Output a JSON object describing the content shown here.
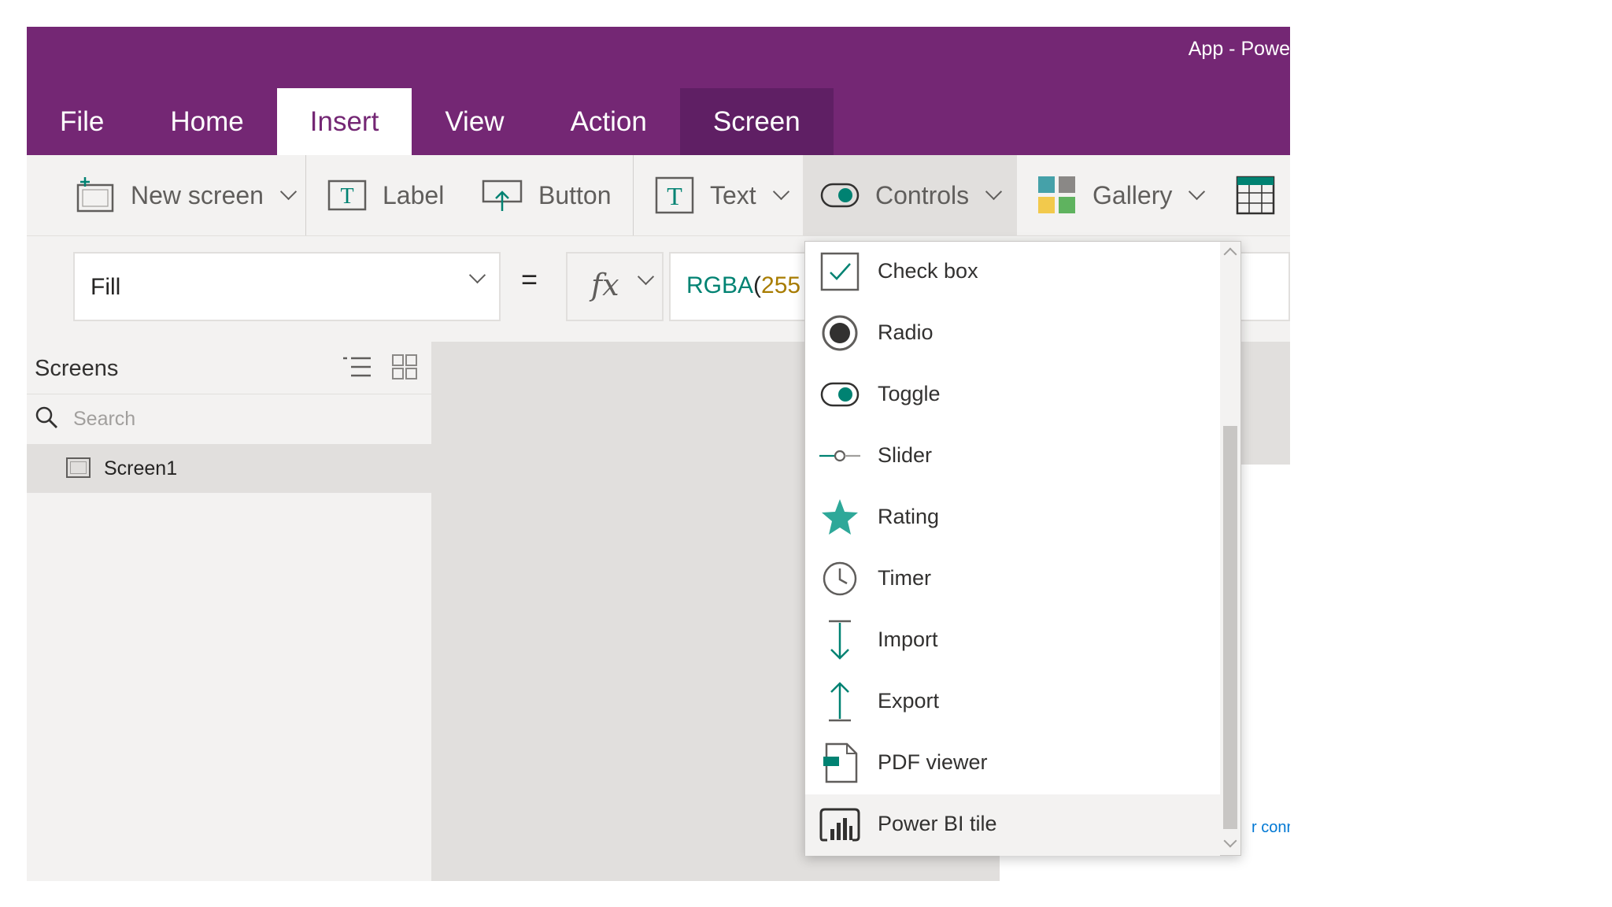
{
  "app_title": "App - Powe",
  "tabs": [
    {
      "label": "File"
    },
    {
      "label": "Home"
    },
    {
      "label": "Insert"
    },
    {
      "label": "View"
    },
    {
      "label": "Action"
    },
    {
      "label": "Screen"
    }
  ],
  "ribbon": {
    "new_screen": "New screen",
    "label": "Label",
    "button": "Button",
    "text": "Text",
    "controls": "Controls",
    "gallery": "Gallery"
  },
  "formula_bar": {
    "property": "Fill",
    "equals": "=",
    "fx": "fx",
    "formula_fn": "RGBA",
    "formula_paren": "(",
    "formula_arg": "255"
  },
  "left_pane": {
    "title": "Screens",
    "search_placeholder": "Search",
    "screens": [
      {
        "label": "Screen1"
      }
    ]
  },
  "controls_menu": {
    "items": [
      {
        "label": "Check box",
        "icon": "checkbox-icon"
      },
      {
        "label": "Radio",
        "icon": "radio-icon"
      },
      {
        "label": "Toggle",
        "icon": "toggle-icon"
      },
      {
        "label": "Slider",
        "icon": "slider-icon"
      },
      {
        "label": "Rating",
        "icon": "star-icon"
      },
      {
        "label": "Timer",
        "icon": "clock-icon"
      },
      {
        "label": "Import",
        "icon": "arrow-down-icon"
      },
      {
        "label": "Export",
        "icon": "arrow-up-icon"
      },
      {
        "label": "PDF viewer",
        "icon": "pdf-icon"
      },
      {
        "label": "Power BI tile",
        "icon": "powerbi-icon"
      }
    ]
  },
  "canvas_link_text": "r conn",
  "colors": {
    "brand": "#742774",
    "contextual_tab": "#5f1f64",
    "accent": "#008272",
    "formula_number": "#a87c00"
  }
}
